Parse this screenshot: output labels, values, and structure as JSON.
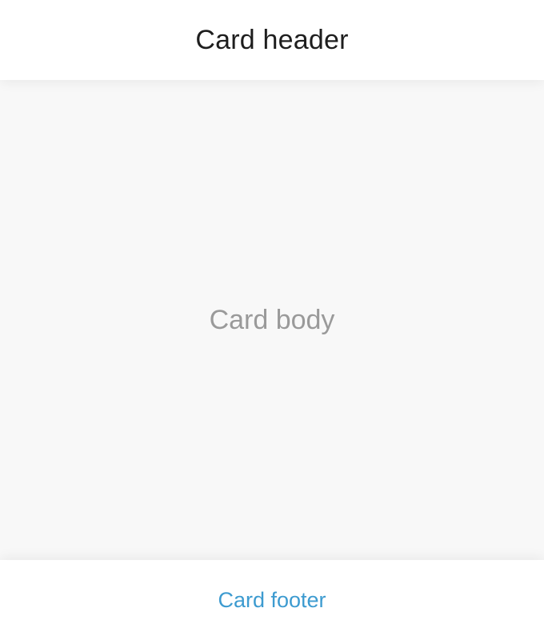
{
  "card": {
    "header": {
      "title": "Card header"
    },
    "body": {
      "text": "Card body"
    },
    "footer": {
      "link_label": "Card footer"
    }
  },
  "colors": {
    "header_bg": "#ffffff",
    "body_bg": "#f8f8f8",
    "title_text": "#1e1e1e",
    "body_text": "#9a9a9a",
    "footer_link": "#3d9bd0"
  }
}
